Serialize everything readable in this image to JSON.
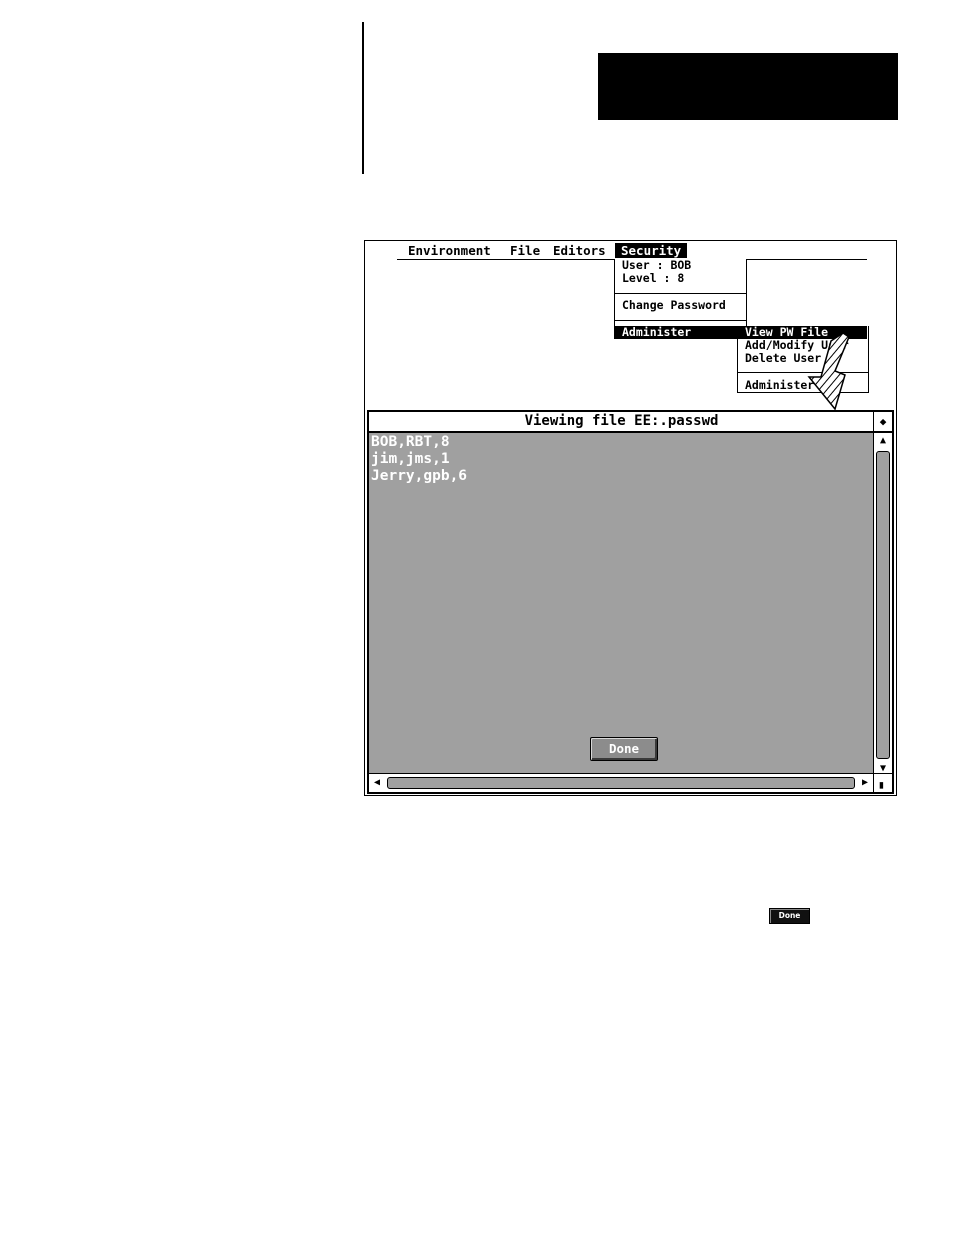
{
  "menubar": {
    "items": [
      "Environment",
      "File",
      "Editors",
      "Security"
    ]
  },
  "security_menu": {
    "user_line": "User : BOB",
    "level_line": "Level : 8",
    "change_password": "Change Password",
    "administer": "Administer"
  },
  "administer_submenu": {
    "items": [
      "View PW File",
      "Add/Modify User",
      "Delete User",
      "Administer"
    ],
    "selected": "View PW File"
  },
  "viewer": {
    "title": "Viewing file EE:.passwd",
    "lines": [
      "BOB,RBT,8",
      "jim,jms,1",
      "Jerry,gpb,6"
    ],
    "done_label": "Done"
  },
  "inline_button": {
    "label": "Done"
  },
  "icons": {
    "corner": "diamond-icon",
    "scroll_up": "up-arrow-icon",
    "scroll_down": "down-arrow-icon",
    "scroll_left": "left-arrow-icon",
    "scroll_right": "right-arrow-icon",
    "pointer": "hatched-pointer-arrow-icon"
  }
}
